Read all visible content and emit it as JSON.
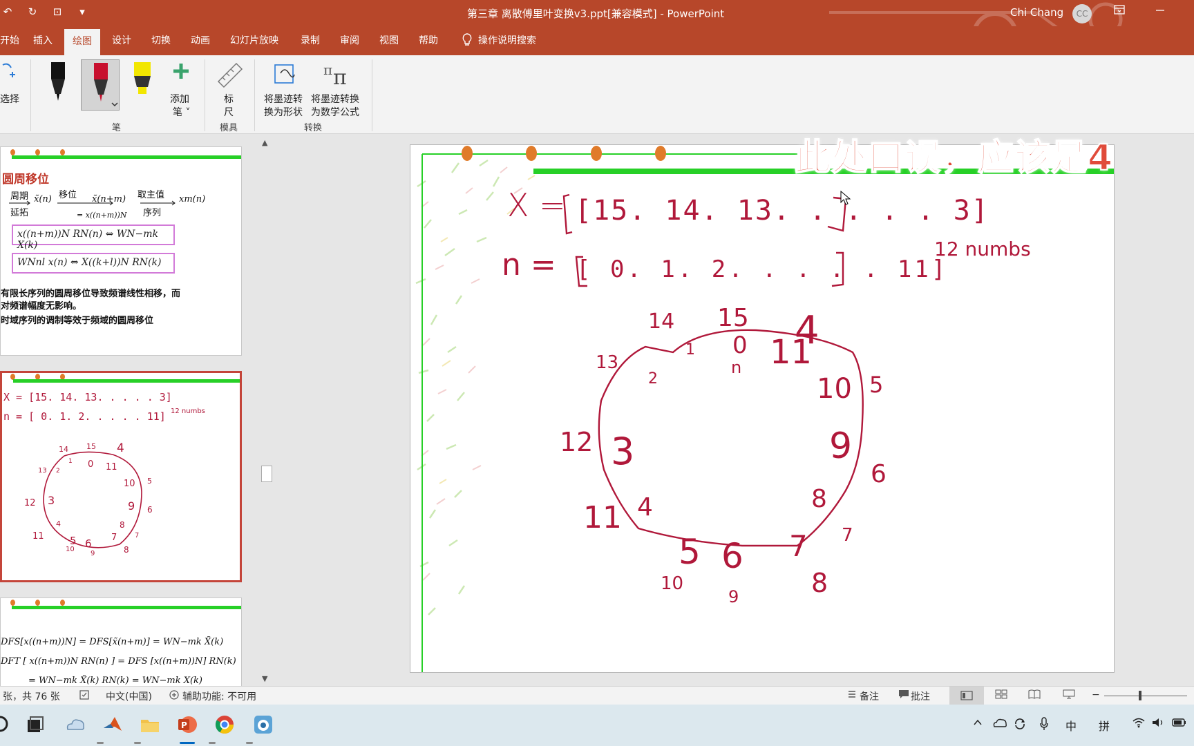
{
  "window": {
    "title": "第三章 离散傅里叶变换v3.ppt[兼容模式]  -  PowerPoint",
    "user_name": "Chi Chang",
    "user_initials": "CC"
  },
  "qat": {
    "undo": "↶",
    "redo": "↻",
    "present": "⊡",
    "customize": "▾"
  },
  "ribbon_tabs": [
    "开始",
    "插入",
    "绘图",
    "设计",
    "切换",
    "动画",
    "幻灯片放映",
    "录制",
    "审阅",
    "视图",
    "帮助"
  ],
  "active_tab": "绘图",
  "tell_me": "操作说明搜索",
  "ribbon": {
    "select_label": "选择",
    "add_pen_label": "添加",
    "add_pen_label2": "笔 ˅",
    "ruler_label": "标",
    "ruler_label2": "尺",
    "ink_to_shape": "将墨迹转",
    "ink_to_shape2": "换为形状",
    "ink_to_math": "将墨迹转换",
    "ink_to_math2": "为数学公式",
    "group_pens": "笔",
    "group_stencils": "模具",
    "group_convert": "转换"
  },
  "thumbnails": {
    "slide1": {
      "title": "圆周移位",
      "periodic_label": "周期",
      "extend_label": "延拓",
      "shift_label": "移位",
      "principal_label": "取主值",
      "sequence_label": "序列",
      "seq_x_tilde": "x̃(n)",
      "seq_x_tilde_shift": "x̃(n+m)",
      "seq_eq": "= x((n+m))N",
      "seq_xm": "xm(n)",
      "formula1": "x((n+m))N RN(n) ⇔ WN−mk X(k)",
      "formula2": "WNnl x(n) ⇔ X((k+l))N RN(k)",
      "note1": "有限长序列的圆周移位导致频谱线性相移，而",
      "note2": "对频谱幅度无影响。",
      "note3": "时域序列的调制等效于频域的圆周移位"
    },
    "slide2": {
      "ink_x": "X = [15. 14. 13. . . . . 3]",
      "ink_n": "n = [ 0. 1. 2. . . . . 11]",
      "ink_note": "12 numbs"
    },
    "slide3": {
      "line1": "DFS[x((n+m))N] = DFS[x̃(n+m)] = WN−mk X̃(k)",
      "line2": "DFT [ x((n+m))N RN(n) ] = DFS [x((n+m))N] RN(k)",
      "line3": "= WN−mk X̃(k) RN(k) = WN−mk X(k)"
    }
  },
  "slide": {
    "ink_x_label": "X =",
    "ink_n_label": "n =",
    "ink_x_values": "[15. 14. 13. . . . . 3]",
    "ink_n_values": "[ 0. 1. 2. . . . . 11]",
    "ink_note": "12 numbs",
    "outer_labels": [
      "14",
      "15",
      "4",
      "13",
      "5",
      "12",
      "6",
      "11",
      "7",
      "10",
      "9",
      "8"
    ],
    "inner_labels": [
      "1",
      "0",
      "11",
      "2",
      "10",
      "3",
      "9",
      "4",
      "8",
      "5",
      "6",
      "7"
    ],
    "inner_n": "n"
  },
  "annotation": "此处口误，应该是4",
  "statusbar": {
    "slide_count": "张，共 76 张",
    "language": "中文(中国)",
    "accessibility": "辅助功能: 不可用",
    "notes": "备注",
    "comments": "批注"
  },
  "taskbar": {
    "ime_lang": "中",
    "ime_mode": "拼"
  },
  "colors": {
    "brand": "#b7472a",
    "ink": "#b0183a",
    "slide_accent": "#27d027",
    "annotation": "#e04b3a"
  }
}
